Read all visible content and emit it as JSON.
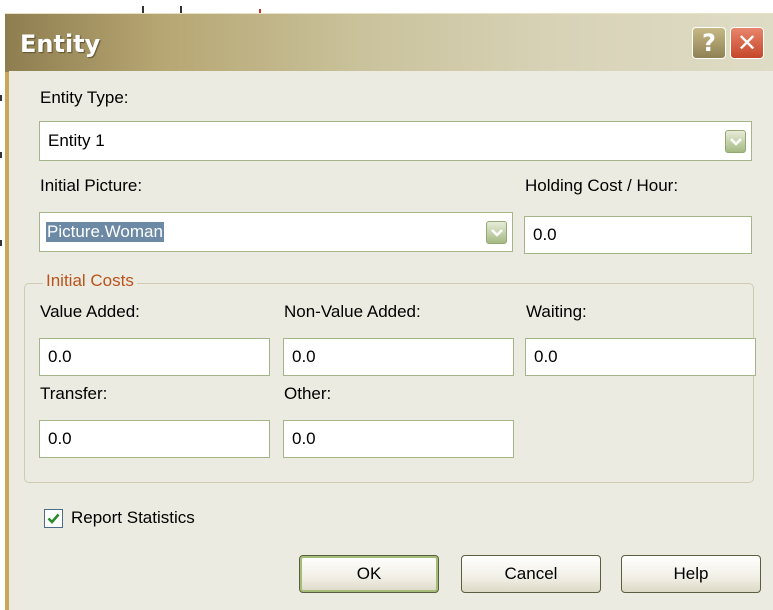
{
  "dialog": {
    "title": "Entity",
    "help_button": "?",
    "close_button": "✕"
  },
  "entity_type": {
    "label": "Entity Type:",
    "value": "Entity 1"
  },
  "initial_picture": {
    "label": "Initial Picture:",
    "value": "Picture.Woman"
  },
  "holding_cost": {
    "label": "Holding Cost / Hour:",
    "value": "0.0"
  },
  "initial_costs": {
    "group_label": "Initial Costs",
    "value_added": {
      "label": "Value Added:",
      "value": "0.0"
    },
    "non_value_added": {
      "label": "Non-Value Added:",
      "value": "0.0"
    },
    "waiting": {
      "label": "Waiting:",
      "value": "0.0"
    },
    "transfer": {
      "label": "Transfer:",
      "value": "0.0"
    },
    "other": {
      "label": "Other:",
      "value": "0.0"
    }
  },
  "report_statistics": {
    "label": "Report Statistics",
    "checked": true
  },
  "buttons": {
    "ok": "OK",
    "cancel": "Cancel",
    "help": "Help"
  },
  "colors": {
    "title_bar_start": "#8e7d4f",
    "title_bar_end": "#dfdcc6",
    "dialog_background": "#ecebe1",
    "group_label": "#b8531b",
    "field_border": "#a5b58a",
    "selection": "#6c8aa5",
    "close_button": "#c5462a"
  }
}
